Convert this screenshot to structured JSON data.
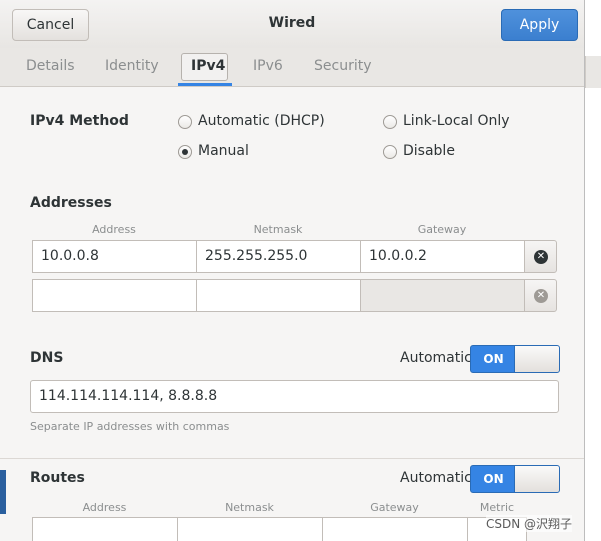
{
  "header": {
    "title": "Wired",
    "cancel_label": "Cancel",
    "apply_label": "Apply"
  },
  "tabs": [
    {
      "label": "Details",
      "active": false
    },
    {
      "label": "Identity",
      "active": false
    },
    {
      "label": "IPv4",
      "active": true
    },
    {
      "label": "IPv6",
      "active": false
    },
    {
      "label": "Security",
      "active": false
    }
  ],
  "ipv4_method": {
    "label": "IPv4 Method",
    "options": [
      {
        "label": "Automatic (DHCP)",
        "selected": false
      },
      {
        "label": "Link-Local Only",
        "selected": false
      },
      {
        "label": "Manual",
        "selected": true
      },
      {
        "label": "Disable",
        "selected": false
      }
    ]
  },
  "addresses": {
    "label": "Addresses",
    "columns": [
      "Address",
      "Netmask",
      "Gateway"
    ],
    "rows": [
      {
        "address": "10.0.0.8",
        "netmask": "255.255.255.0",
        "gateway": "10.0.0.2"
      },
      {
        "address": "",
        "netmask": "",
        "gateway": ""
      }
    ]
  },
  "dns": {
    "label": "DNS",
    "automatic_label": "Automatic",
    "switch_label": "ON",
    "value": "114.114.114.114, 8.8.8.8",
    "hint": "Separate IP addresses with commas"
  },
  "routes": {
    "label": "Routes",
    "automatic_label": "Automatic",
    "switch_label": "ON",
    "columns": [
      "Address",
      "Netmask",
      "Gateway",
      "Metric"
    ]
  },
  "watermark": "CSDN @沢翔子",
  "colors": {
    "accent": "#3584e4",
    "window_bg": "#f6f5f4"
  }
}
